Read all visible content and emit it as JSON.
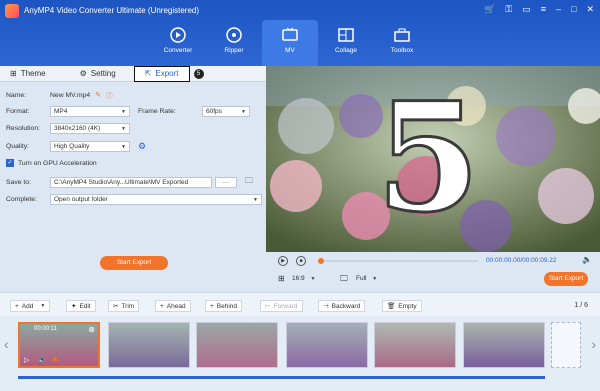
{
  "app": {
    "title": "AnyMP4 Video Converter Ultimate (Unregistered)"
  },
  "nav": {
    "items": [
      {
        "label": "Converter"
      },
      {
        "label": "Ripper"
      },
      {
        "label": "MV"
      },
      {
        "label": "Collage"
      },
      {
        "label": "Toolbox"
      }
    ]
  },
  "subtabs": {
    "theme": "Theme",
    "setting": "Setting",
    "export": "Export",
    "help": "5"
  },
  "form": {
    "name_label": "Name:",
    "name_value": "New MV.mp4",
    "format_label": "Format:",
    "format_value": "MP4",
    "framerate_label": "Frame Rate:",
    "framerate_value": "60fps",
    "resolution_label": "Resolution:",
    "resolution_value": "3840x2160 (4K)",
    "quality_label": "Quality:",
    "quality_value": "High Quality",
    "gpu_label": "Turn on GPU Acceleration",
    "saveto_label": "Save to:",
    "saveto_value": "C:\\AnyMP4 Studio\\Any...Ultimate\\MV Exported",
    "saveto_more": "···",
    "complete_label": "Complete:",
    "complete_value": "Open output folder"
  },
  "start_export": "Start Export",
  "preview": {
    "overlay_number": "5"
  },
  "player": {
    "time": "00:00:00.00/00:00:09.22",
    "aspect": "16:9",
    "zoom": "Full",
    "export": "Start Export"
  },
  "toolbar": {
    "add": "Add",
    "edit": "Edit",
    "trim": "Trim",
    "ahead": "Ahead",
    "behind": "Behind",
    "forward": "Forward",
    "backward": "Backward",
    "empty": "Empty",
    "page": "1 / 6"
  },
  "timeline": {
    "first_clip_time": "00:00:11"
  },
  "colors": {
    "brand": "#1d55c3",
    "accent": "#f2732a",
    "selection": "#2b64d1"
  }
}
